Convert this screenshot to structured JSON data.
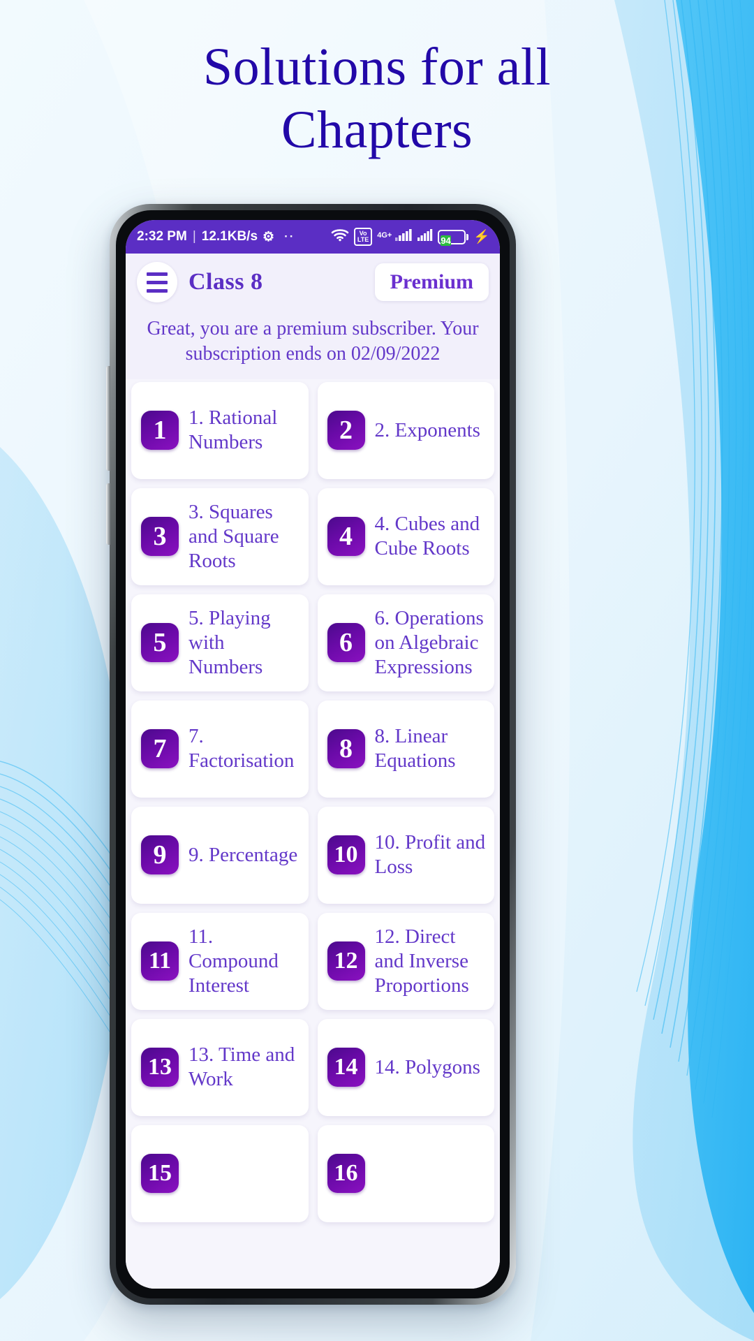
{
  "hero": {
    "line1": "Solutions for all",
    "line2": "Chapters",
    "color": "#2208a8"
  },
  "statusbar": {
    "time": "2:32 PM",
    "separator": "|",
    "data_rate": "12.1KB/s",
    "gear_icon": "gear-icon",
    "overflow_dots": "··",
    "wifi_icon": "wifi-icon",
    "volte_top": "Vo",
    "volte_bottom": "LTE",
    "network_type": "4G+",
    "battery_percent": "94",
    "charging_icon": "charging-bolt-icon",
    "background_color": "#5b2ec4"
  },
  "appbar": {
    "menu_icon": "hamburger-menu-icon",
    "title": "Class  8",
    "premium_label": "Premium"
  },
  "subscription": {
    "message": "Great, you are a premium subscriber. Your subscription ends on  02/09/2022",
    "end_date": "02/09/2022"
  },
  "chapters": [
    {
      "number": "1",
      "label": "1. Rational Numbers"
    },
    {
      "number": "2",
      "label": "2. Exponents"
    },
    {
      "number": "3",
      "label": "3. Squares and Square Roots"
    },
    {
      "number": "4",
      "label": "4. Cubes and Cube Roots"
    },
    {
      "number": "5",
      "label": "5. Playing with Numbers"
    },
    {
      "number": "6",
      "label": "6. Operations on Algebraic Expressions"
    },
    {
      "number": "7",
      "label": "7. Factorisation"
    },
    {
      "number": "8",
      "label": "8. Linear Equations"
    },
    {
      "number": "9",
      "label": "9. Percentage"
    },
    {
      "number": "10",
      "label": "10. Profit and Loss"
    },
    {
      "number": "11",
      "label": "11. Compound Interest"
    },
    {
      "number": "12",
      "label": "12. Direct and Inverse Proportions"
    },
    {
      "number": "13",
      "label": "13. Time and Work"
    },
    {
      "number": "14",
      "label": "14. Polygons"
    },
    {
      "number": "15",
      "label": ""
    },
    {
      "number": "16",
      "label": ""
    }
  ],
  "theme": {
    "accent_purple": "#5b2ec4",
    "badge_purple": "#6a0aa8",
    "text_purple": "#6338c9",
    "card_white": "#ffffff",
    "screen_bg": "#f6f5fc",
    "battery_green": "#2bbd3e",
    "page_blue": "#29b6f6"
  }
}
